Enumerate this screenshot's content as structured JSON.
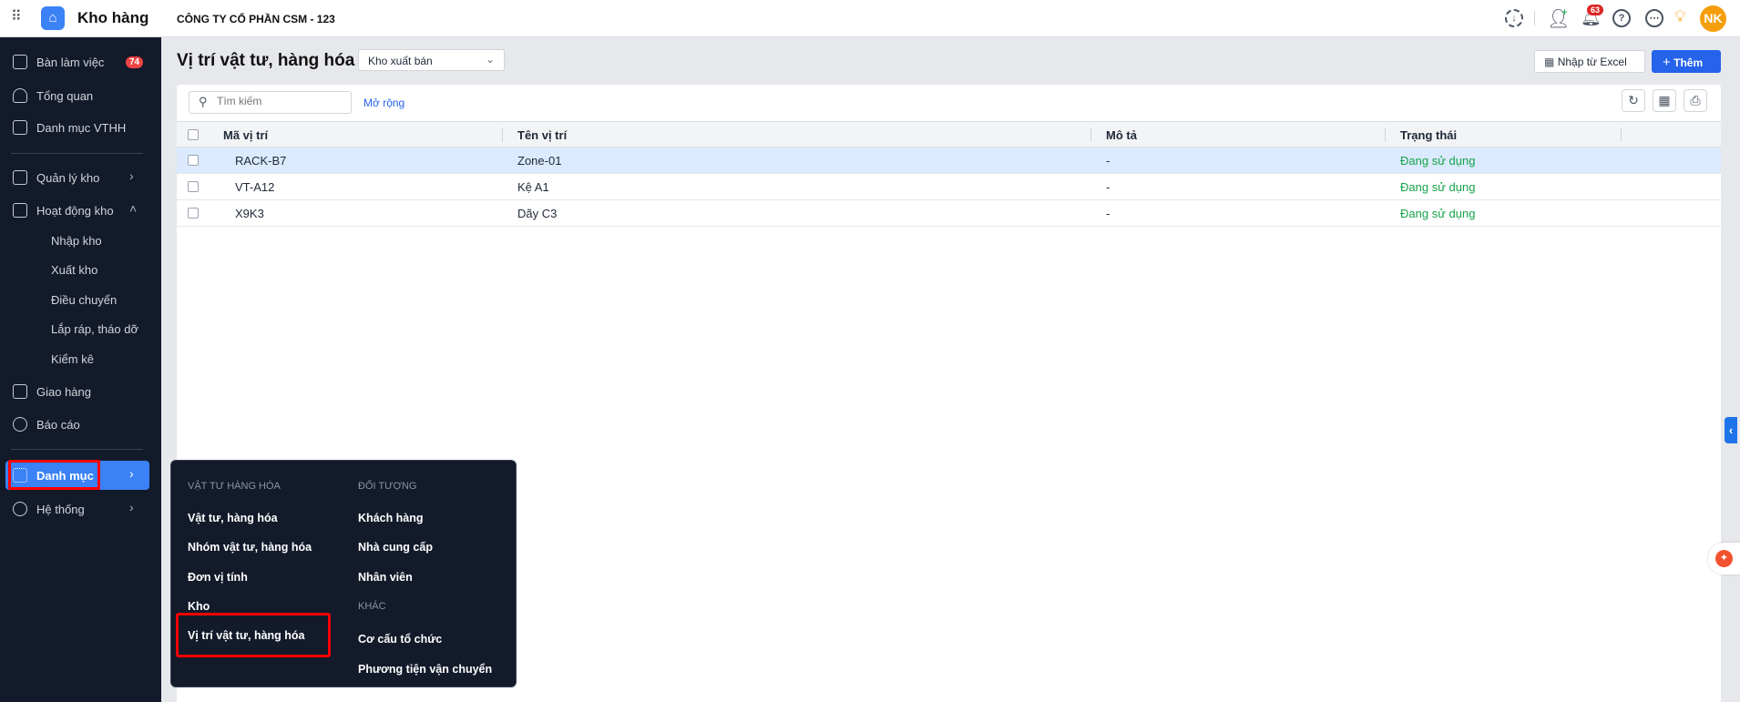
{
  "header": {
    "app_title": "Kho hàng",
    "company": "CÔNG TY CỔ PHẦN CSM - 123",
    "notification_count": "63",
    "avatar_initials": "NK"
  },
  "sidebar": {
    "items": [
      {
        "label": "Bàn làm việc",
        "badge": "74"
      },
      {
        "label": "Tổng quan"
      },
      {
        "label": "Danh mục VTHH"
      },
      {
        "label": "Quản lý kho"
      },
      {
        "label": "Hoạt động kho"
      },
      {
        "label": "Giao hàng"
      },
      {
        "label": "Báo cáo"
      },
      {
        "label": "Danh mục"
      },
      {
        "label": "Hệ thống"
      }
    ],
    "sub_items": [
      "Nhập kho",
      "Xuất kho",
      "Điều chuyển",
      "Lắp ráp, tháo dỡ",
      "Kiểm kê"
    ]
  },
  "page": {
    "title": "Vị trí vật tư, hàng hóa",
    "warehouse_select": "Kho xuất bán",
    "import_button": "Nhập từ Excel",
    "add_button": "Thêm",
    "search_placeholder": "Tìm kiếm",
    "expand_link": "Mở rộng"
  },
  "table": {
    "columns": [
      "Mã vị trí",
      "Tên vị trí",
      "Mô tả",
      "Trạng thái"
    ],
    "rows": [
      {
        "code": "RACK-B7",
        "name": "Zone-01",
        "desc": "-",
        "status": "Đang sử dụng"
      },
      {
        "code": "VT-A12",
        "name": "Kệ A1",
        "desc": "-",
        "status": "Đang sử dụng"
      },
      {
        "code": "X9K3",
        "name": "Dãy C3",
        "desc": "-",
        "status": "Đang sử dụng"
      }
    ]
  },
  "menu": {
    "col1_header": "VẬT TƯ HÀNG HÓA",
    "col1": [
      "Vật tư, hàng hóa",
      "Nhóm vật tư, hàng hóa",
      "Đơn vị tính",
      "Kho",
      "Vị trí vật tư, hàng hóa"
    ],
    "col2_header": "ĐỐI TƯỢNG",
    "col2": [
      "Khách hàng",
      "Nhà cung cấp",
      "Nhân viên"
    ],
    "col3_header": "KHÁC",
    "col3": [
      "Cơ cấu tổ chức",
      "Phương tiện vận chuyển"
    ]
  },
  "colors": {
    "accent": "#2563eb",
    "sidebar": "#131a2a",
    "status_green": "#16a34a",
    "highlight": "#ff0000"
  }
}
